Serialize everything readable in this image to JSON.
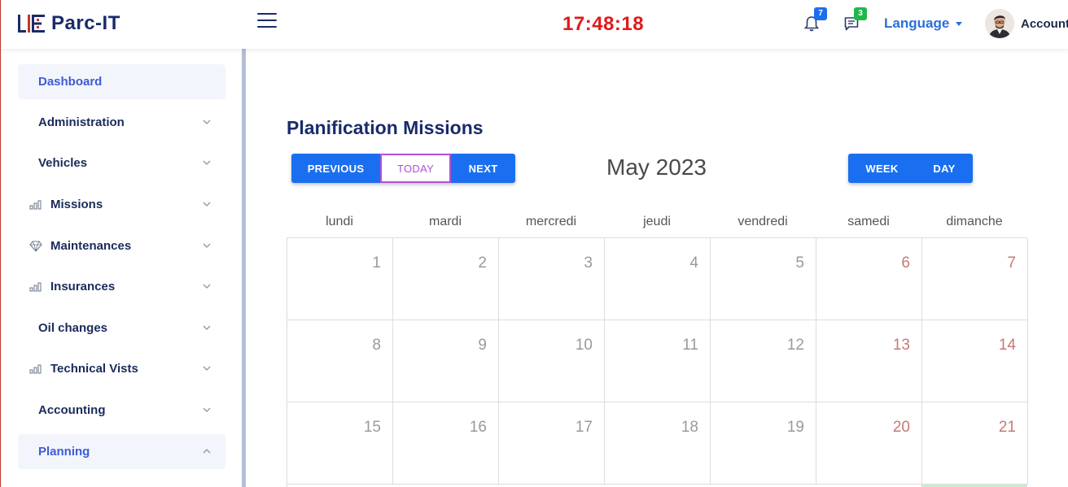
{
  "header": {
    "brand": "Parc-IT",
    "clock": "17:48:18",
    "notifications_count": "7",
    "messages_count": "3",
    "language_label": "Language",
    "account_label": "Account"
  },
  "sidebar": {
    "items": [
      {
        "label": "Dashboard",
        "icon": "none",
        "state": "active"
      },
      {
        "label": "Administration",
        "icon": "none",
        "state": "collapsed"
      },
      {
        "label": "Vehicles",
        "icon": "none",
        "state": "collapsed"
      },
      {
        "label": "Missions",
        "icon": "bar-chart-icon",
        "state": "collapsed"
      },
      {
        "label": "Maintenances",
        "icon": "diamond-icon",
        "state": "collapsed"
      },
      {
        "label": "Insurances",
        "icon": "bar-chart-icon",
        "state": "collapsed"
      },
      {
        "label": "Oil changes",
        "icon": "none",
        "state": "collapsed"
      },
      {
        "label": "Technical Vists",
        "icon": "bar-chart-icon",
        "state": "collapsed"
      },
      {
        "label": "Accounting",
        "icon": "none",
        "state": "collapsed"
      },
      {
        "label": "Planning",
        "icon": "none",
        "state": "expanded"
      }
    ]
  },
  "main": {
    "title": "Planification Missions",
    "buttons": {
      "previous": "PREVIOUS",
      "today": "TODAY",
      "next": "NEXT",
      "week": "WEEK",
      "day": "DAY"
    },
    "month_title": "May 2023",
    "weekdays": [
      "lundi",
      "mardi",
      "mercredi",
      "jeudi",
      "vendredi",
      "samedi",
      "dimanche"
    ],
    "weeks": [
      [
        "1",
        "2",
        "3",
        "4",
        "5",
        "6",
        "7"
      ],
      [
        "8",
        "9",
        "10",
        "11",
        "12",
        "13",
        "14"
      ],
      [
        "15",
        "16",
        "17",
        "18",
        "19",
        "20",
        "21"
      ]
    ]
  },
  "colors": {
    "accent": "#1a6ff0",
    "clock": "#e01a1a",
    "brand": "#1a2b6b",
    "weekend_day": "#c47a76",
    "today_outline": "#b050d8"
  }
}
